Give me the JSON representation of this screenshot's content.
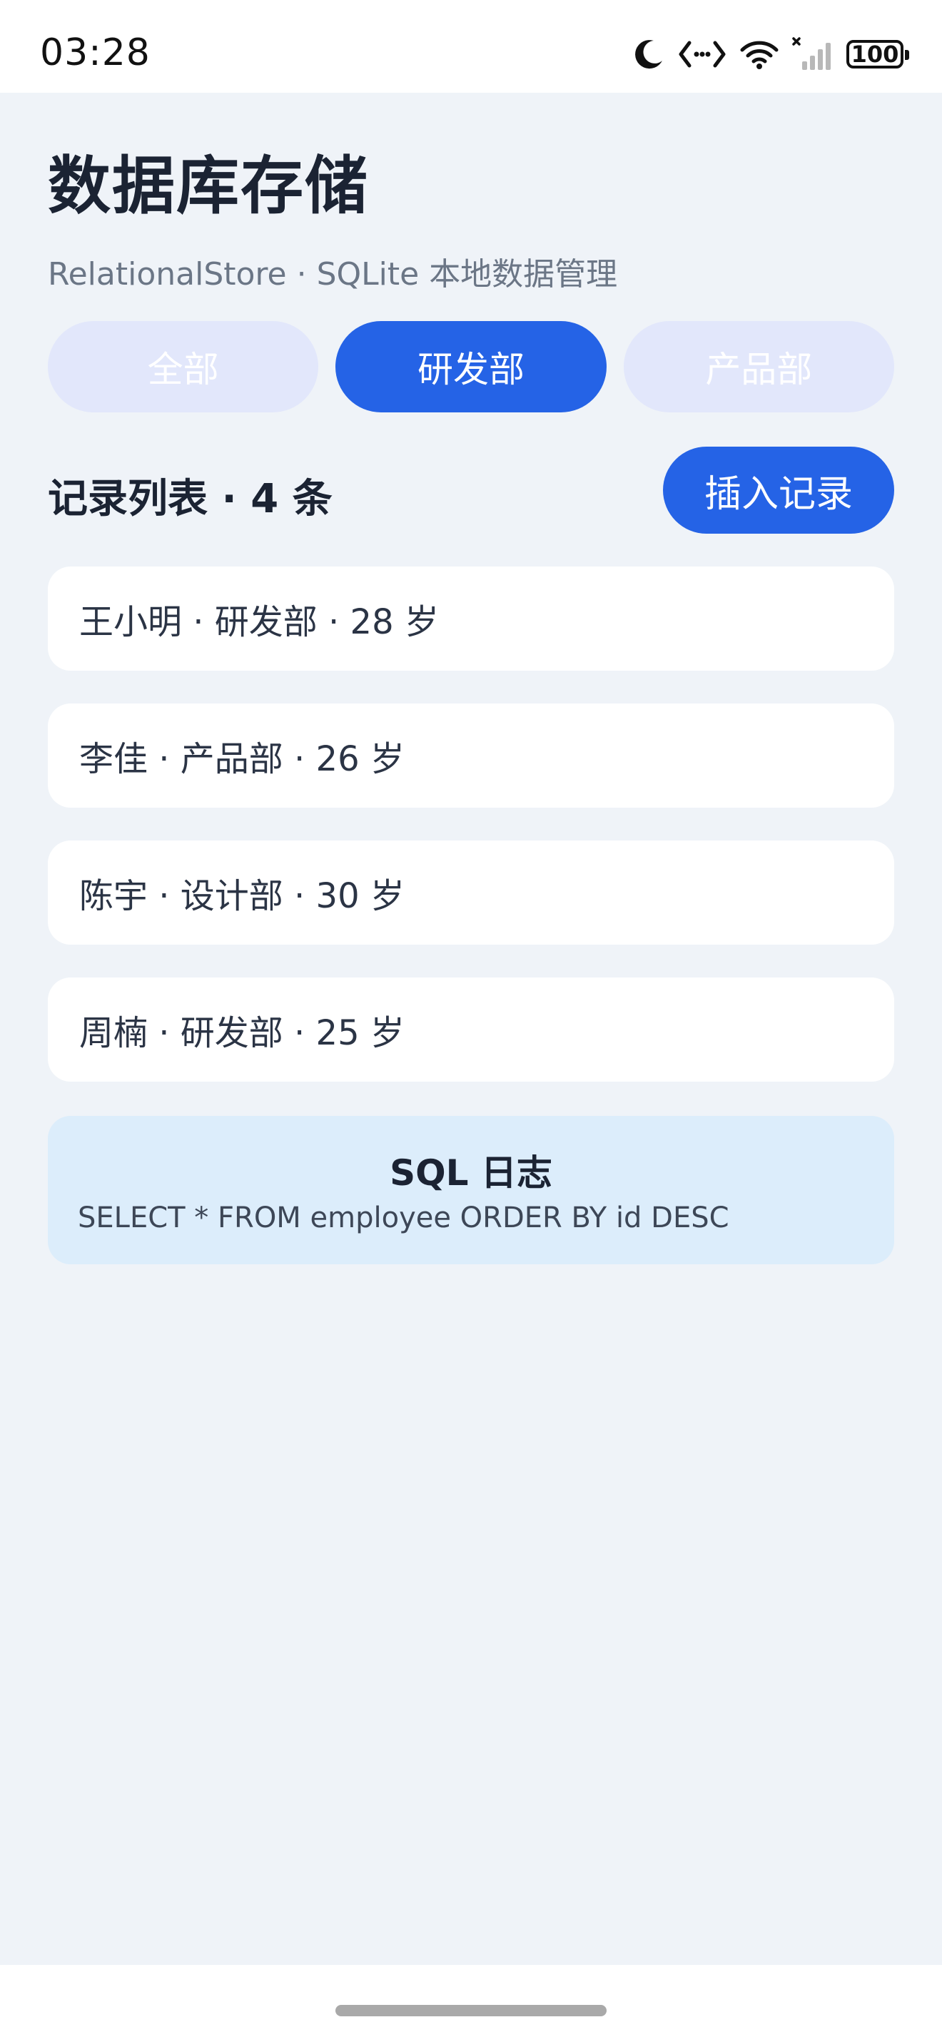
{
  "status_bar": {
    "time": "03:28",
    "battery": "100"
  },
  "header": {
    "title": "数据库存储",
    "subtitle": "RelationalStore · SQLite 本地数据管理"
  },
  "filters": {
    "tabs": [
      {
        "label": "全部",
        "active": false
      },
      {
        "label": "研发部",
        "active": true
      },
      {
        "label": "产品部",
        "active": false
      }
    ]
  },
  "list": {
    "title": "记录列表 · 4 条",
    "insert_label": "插入记录",
    "records": [
      {
        "text": "王小明 · 研发部 · 28 岁"
      },
      {
        "text": "李佳 · 产品部 · 26 岁"
      },
      {
        "text": "陈宇 · 设计部 · 30 岁"
      },
      {
        "text": "周楠 · 研发部 · 25 岁"
      }
    ]
  },
  "sql_log": {
    "title": "SQL 日志",
    "text": "SELECT * FROM employee ORDER BY id DESC"
  },
  "colors": {
    "accent": "#2563e6",
    "inactive_tab": "#e2e7fb",
    "background": "#eff3f8",
    "sql_log_bg": "#dcedfb"
  },
  "icons": [
    "moon-icon",
    "code-icon",
    "wifi-icon",
    "signal-icon",
    "battery-icon"
  ]
}
